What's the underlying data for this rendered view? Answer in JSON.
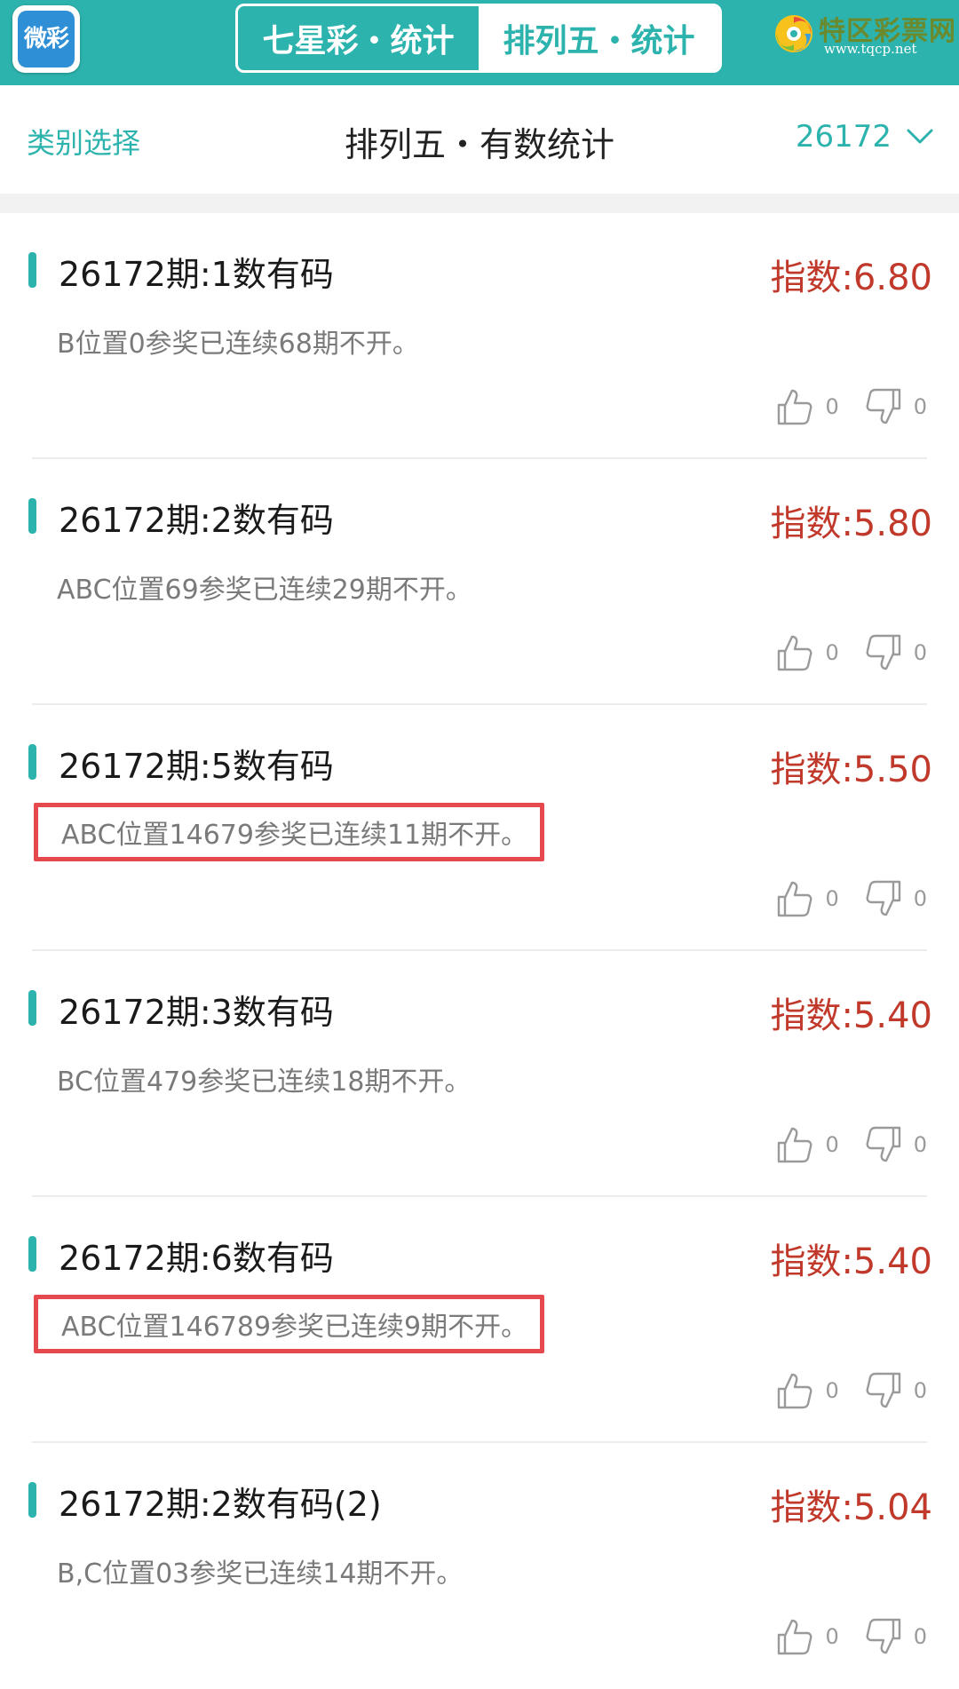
{
  "header": {
    "logo_text": "微彩",
    "tabs": [
      {
        "label": "七星彩・统计",
        "active": false
      },
      {
        "label": "排列五・统计",
        "active": true
      }
    ],
    "brand_name": "特区彩票网",
    "brand_url": "www.tqcp.net"
  },
  "subheader": {
    "category_label": "类别选择",
    "title": "排列五・有数统计",
    "issue": "26172"
  },
  "colors": {
    "accent": "#2db3ad",
    "index_red": "#c0392b",
    "highlight_border": "#e5484d"
  },
  "items": [
    {
      "title": "26172期:1数有码",
      "index": "指数:6.80",
      "desc": "B位置0参奖已连续68期不开。",
      "highlight": false,
      "likes": "0",
      "dislikes": "0"
    },
    {
      "title": "26172期:2数有码",
      "index": "指数:5.80",
      "desc": "ABC位置69参奖已连续29期不开。",
      "highlight": false,
      "likes": "0",
      "dislikes": "0"
    },
    {
      "title": "26172期:5数有码",
      "index": "指数:5.50",
      "desc": "ABC位置14679参奖已连续11期不开。",
      "highlight": true,
      "likes": "0",
      "dislikes": "0"
    },
    {
      "title": "26172期:3数有码",
      "index": "指数:5.40",
      "desc": "BC位置479参奖已连续18期不开。",
      "highlight": false,
      "likes": "0",
      "dislikes": "0"
    },
    {
      "title": "26172期:6数有码",
      "index": "指数:5.40",
      "desc": "ABC位置146789参奖已连续9期不开。",
      "highlight": true,
      "likes": "0",
      "dislikes": "0"
    },
    {
      "title": "26172期:2数有码(2)",
      "index": "指数:5.04",
      "desc": "B,C位置03参奖已连续14期不开。",
      "highlight": false,
      "likes": "0",
      "dislikes": "0"
    }
  ]
}
